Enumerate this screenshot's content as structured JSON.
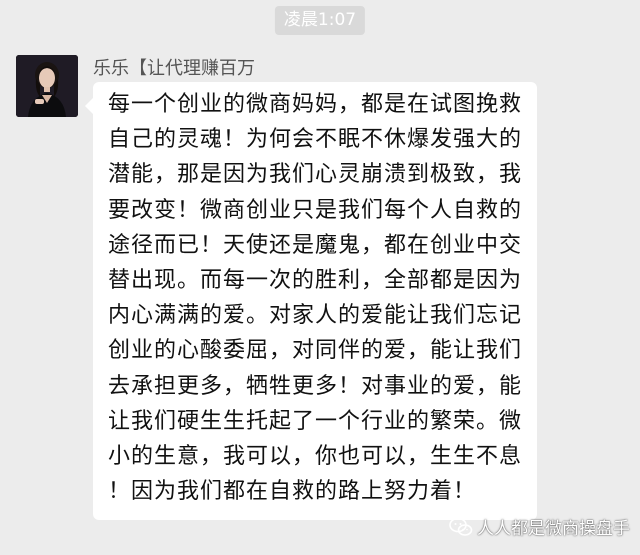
{
  "timestamp": "凌晨1:07",
  "sender": {
    "name": "乐乐【让代理赚百万",
    "avatar_icon": "person-avatar"
  },
  "message": {
    "text": "每一个创业的微商妈妈，都是在试图挽救自己的灵魂！为何会不眠不休爆发强大的潜能，那是因为我们心灵崩溃到极致，我要改变！微商创业只是我们每个人自救的途径而已！天使还是魔鬼，都在创业中交替出现。而每一次的胜利，全部都是因为内心满满的爱。对家人的爱能让我们忘记创业的心酸委屈，对同伴的爱，能让我们去承担更多，牺牲更多！对事业的爱，能让我们硬生生托起了一个行业的繁荣。微小的生意，我可以，你也可以，生生不息！因为我们都在自救的路上努力着！"
  },
  "watermark": {
    "icon": "wechat-icon",
    "text": "人人都是微商操盘手"
  },
  "colors": {
    "background": "#ececec",
    "bubble": "#ffffff",
    "timestamp_bg": "#d9d9d9"
  }
}
